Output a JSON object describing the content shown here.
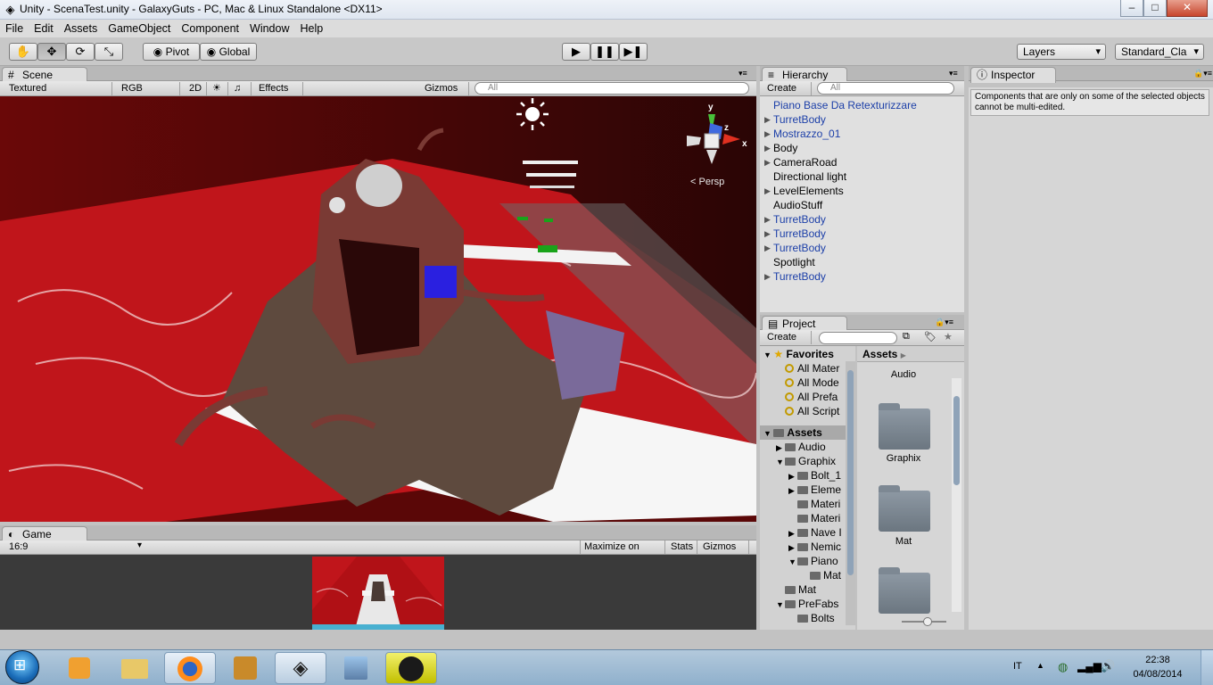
{
  "window": {
    "title": "Unity - ScenaTest.unity - GalaxyGuts - PC, Mac & Linux Standalone <DX11>",
    "minimize": "–",
    "maximize": "□",
    "close": "✕"
  },
  "menu": [
    "File",
    "Edit",
    "Assets",
    "GameObject",
    "Component",
    "Window",
    "Help"
  ],
  "toolbar": {
    "pivot": "Pivot",
    "global": "Global",
    "layers": "Layers",
    "layout": "Standard_Cla"
  },
  "scene": {
    "tab": "Scene",
    "shading": "Textured",
    "render": "RGB",
    "mode2d": "2D",
    "effects": "Effects",
    "gizmos": "Gizmos",
    "search_placeholder": "All",
    "persp_label": "Persp",
    "axis_y": "y",
    "axis_z": "z",
    "axis_x": "x"
  },
  "game": {
    "tab": "Game",
    "aspect": "16:9",
    "maximize": "Maximize on Play",
    "stats": "Stats",
    "gizmos": "Gizmos"
  },
  "hierarchy": {
    "tab": "Hierarchy",
    "create": "Create",
    "search_placeholder": "All",
    "items": [
      {
        "label": "Piano Base Da Retexturizzare",
        "prefab": true,
        "expandable": false
      },
      {
        "label": "TurretBody",
        "prefab": true,
        "expandable": true
      },
      {
        "label": "Mostrazzo_01",
        "prefab": true,
        "expandable": true
      },
      {
        "label": "Body",
        "prefab": false,
        "expandable": true
      },
      {
        "label": "CameraRoad",
        "prefab": false,
        "expandable": true
      },
      {
        "label": "Directional light",
        "prefab": false,
        "expandable": false
      },
      {
        "label": "LevelElements",
        "prefab": false,
        "expandable": true
      },
      {
        "label": "AudioStuff",
        "prefab": false,
        "expandable": false
      },
      {
        "label": "TurretBody",
        "prefab": true,
        "expandable": true
      },
      {
        "label": "TurretBody",
        "prefab": true,
        "expandable": true
      },
      {
        "label": "TurretBody",
        "prefab": true,
        "expandable": true
      },
      {
        "label": "Spotlight",
        "prefab": false,
        "expandable": false
      },
      {
        "label": "TurretBody",
        "prefab": true,
        "expandable": true
      }
    ]
  },
  "project": {
    "tab": "Project",
    "create": "Create",
    "favorites_label": "Favorites",
    "favorites": [
      "All Mater",
      "All Mode",
      "All Prefa",
      "All Script"
    ],
    "assets_label": "Assets",
    "tree": [
      {
        "label": "Audio",
        "depth": 1,
        "arrow": "▶"
      },
      {
        "label": "Graphix",
        "depth": 1,
        "arrow": "▼"
      },
      {
        "label": "Bolt_1",
        "depth": 2,
        "arrow": "▶"
      },
      {
        "label": "Eleme",
        "depth": 2,
        "arrow": "▶"
      },
      {
        "label": "Materi",
        "depth": 2,
        "arrow": ""
      },
      {
        "label": "Materi",
        "depth": 2,
        "arrow": ""
      },
      {
        "label": "Nave I",
        "depth": 2,
        "arrow": "▶"
      },
      {
        "label": "Nemic",
        "depth": 2,
        "arrow": "▶"
      },
      {
        "label": "Piano",
        "depth": 2,
        "arrow": "▼"
      },
      {
        "label": "Mat",
        "depth": 3,
        "arrow": ""
      },
      {
        "label": "Mat",
        "depth": 1,
        "arrow": ""
      },
      {
        "label": "PreFabs",
        "depth": 1,
        "arrow": "▼"
      },
      {
        "label": "Bolts",
        "depth": 2,
        "arrow": ""
      }
    ],
    "grid_header": "Assets",
    "grid_items": [
      "Audio",
      "Graphix",
      "Mat"
    ]
  },
  "inspector": {
    "tab": "Inspector",
    "message": "Components that are only on some of the selected objects cannot be multi-edited."
  },
  "taskbar": {
    "lang": "IT",
    "time": "22:38",
    "date": "04/08/2014"
  },
  "colors": {
    "prefab": "#1c3fa8",
    "scene_floor": "#c0151b"
  }
}
